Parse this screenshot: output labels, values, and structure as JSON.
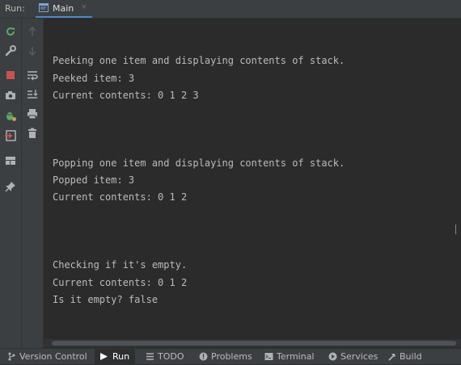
{
  "run_panel": {
    "label": "Run:",
    "tab": {
      "label": "Main",
      "close": "×"
    }
  },
  "console": {
    "lines": [
      "Peeking one item and displaying contents of stack.",
      "Peeked item: 3",
      "Current contents: 0 1 2 3",
      "Popping one item and displaying contents of stack.",
      "Popped item: 3",
      "Current contents: 0 1 2",
      "Checking if it's empty.",
      "Current contents: 0 1 2",
      "Is it empty? false"
    ]
  },
  "left_toolbar": [
    {
      "icon": "rerun-icon"
    },
    {
      "icon": "wrench-icon"
    },
    {
      "icon": "stop-icon"
    },
    {
      "icon": "camera-icon"
    },
    {
      "icon": "debug-bug-icon"
    },
    {
      "icon": "exit-icon"
    },
    {
      "icon": "layout-icon"
    },
    {
      "icon": "pin-icon"
    }
  ],
  "secondary_toolbar": [
    {
      "icon": "arrow-up-icon"
    },
    {
      "icon": "arrow-down-icon"
    },
    {
      "icon": "soft-wrap-icon"
    },
    {
      "icon": "scroll-to-end-icon"
    },
    {
      "icon": "print-icon"
    },
    {
      "icon": "trash-icon"
    }
  ],
  "status_bar": {
    "items": [
      {
        "label": "Version Control",
        "icon": "branch-icon"
      },
      {
        "label": "Run",
        "icon": "play-icon",
        "active": true
      },
      {
        "label": "TODO",
        "icon": "list-icon"
      },
      {
        "label": "Problems",
        "icon": "alert-icon"
      },
      {
        "label": "Terminal",
        "icon": "terminal-icon"
      },
      {
        "label": "Services",
        "icon": "services-icon"
      },
      {
        "label": "Build",
        "icon": "hammer-icon"
      }
    ]
  },
  "colors": {
    "accent": "#4a88c7",
    "stop_red": "#c75450",
    "run_green": "#59a869"
  }
}
